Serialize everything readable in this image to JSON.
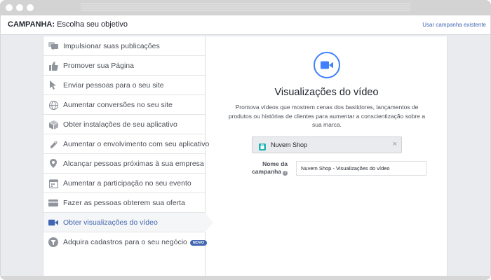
{
  "header": {
    "campaign_label": "CAMPANHA:",
    "campaign_text": "Escolha seu objetivo",
    "use_existing_link": "Usar campanha existente"
  },
  "objectives": [
    {
      "label": "Impulsionar suas publicações",
      "icon": "chat-bubbles-icon"
    },
    {
      "label": "Promover sua Página",
      "icon": "thumbs-up-icon"
    },
    {
      "label": "Enviar pessoas para o seu site",
      "icon": "cursor-icon"
    },
    {
      "label": "Aumentar conversões no seu site",
      "icon": "globe-icon"
    },
    {
      "label": "Obter instalações de seu aplicativo",
      "icon": "box-icon"
    },
    {
      "label": "Aumentar o envolvimento com seu aplicativo",
      "icon": "gamepad-icon"
    },
    {
      "label": "Alcançar pessoas próximas à sua empresa",
      "icon": "map-pin-icon"
    },
    {
      "label": "Aumentar a participação no seu evento",
      "icon": "calendar-icon"
    },
    {
      "label": "Fazer as pessoas obterem sua oferta",
      "icon": "offer-icon"
    },
    {
      "label": "Obter visualizações do vídeo",
      "icon": "video-camera-icon",
      "selected": true
    },
    {
      "label": "Adquira cadastros para o seu negócio",
      "icon": "funnel-icon",
      "badge": "NOVO"
    }
  ],
  "detail": {
    "icon": "video-camera-icon",
    "title": "Visualizações do vídeo",
    "description": "Promova vídeos que mostrem cenas dos bastidores, lançamentos de produtos ou histórias de clientes para aumentar a conscientização sobre a sua marca.",
    "page_name": "Nuvem Shop",
    "page_remove": "×",
    "campaign_name_label_line1": "Nome da",
    "campaign_name_label_line2": "campanha",
    "info_icon_text": "i",
    "campaign_name_value": "Nuvem Shop - Visualizações do vídeo"
  },
  "colors": {
    "accent": "#4267b2",
    "video_icon": "#4080ff",
    "page_bg": "#e9ebee",
    "text": "#1d2129",
    "muted": "#4b4f56",
    "icon_gray": "#90949c"
  }
}
